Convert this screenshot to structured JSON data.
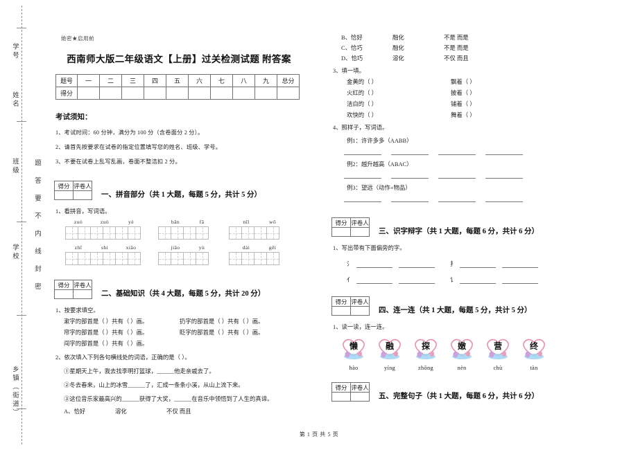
{
  "sidebar": {
    "col_right_text": "题  答  要  不  内  线  封  密",
    "fields": [
      "学号",
      "姓名",
      "班级",
      "学校",
      "乡镇（街道）"
    ]
  },
  "header": {
    "secret_mark": "绝密★启用前",
    "title": "西南师大版二年级语文【上册】过关检测试题 附答案"
  },
  "score_table": {
    "row1_label": "题号",
    "row2_label": "得分",
    "columns": [
      "一",
      "二",
      "三",
      "四",
      "五",
      "六",
      "七",
      "八",
      "九",
      "总分"
    ]
  },
  "notice": {
    "title": "考试须知：",
    "items": [
      "1、考试时间：60 分钟，满分为 100 分（含卷面分 2 分）。",
      "2、请首先按要求在试卷的指定位置填写您的姓名、班级、学号。",
      "3、不要在试卷上乱写乱画，卷面不整洁扣 2 分。"
    ]
  },
  "grader_box": {
    "score_label": "得分",
    "grader_label": "评卷人"
  },
  "sections": {
    "s1": {
      "title": "一、拼音部分（共 1 大题，每题 5 分，共计 5 分）",
      "q1": "1、看拼音，写词语。",
      "groups": [
        {
          "pinyin": [
            "zuò",
            "zuò",
            "yè"
          ],
          "cells": 6
        },
        {
          "pinyin": [
            "bān",
            "fā"
          ],
          "cells": 4
        },
        {
          "pinyin": [
            "nǐl",
            "wǒ"
          ],
          "cells": 4
        },
        {
          "pinyin": [
            "zhī",
            "shi",
            "xiǎo"
          ],
          "cells": 6
        },
        {
          "pinyin": [
            "jiāo",
            "yù"
          ],
          "cells": 4
        },
        {
          "pinyin": [
            "dài",
            "gěi"
          ],
          "cells": 4
        }
      ]
    },
    "s2": {
      "title": "二、基础知识（共 4 大题，每题 5 分，共计 20 分）",
      "q1": "1、按要求填空。",
      "q1_rows": [
        {
          "left": "漱字的部首是（      ）共有（      ）画。",
          "right": "扔字的部首是（      ）共有（      ）画。"
        },
        {
          "left": "帘字的部首是（      ）共有（      ）画。",
          "right": "眨字的部首是（      ）共有（      ）画。"
        },
        {
          "left": "闯字的部首是（      ）共有（      ）画。",
          "right": ""
        }
      ],
      "q2": "2、依次填入下列各句横线处的词语，正确的是（     ）。",
      "q2_items": [
        "①星期天上午，我去找李明打篮球，______他走亲戚去了。",
        "②冬去春来，山上的冰雪______了，汇成一条条小溪，从山上流下来。",
        "③这位音乐家最高兴的______获得了大奖，______在音乐中领悟到了人生的真谛。"
      ],
      "choices": [
        {
          "label": "A、",
          "o1": "恰好",
          "o2": "溶化",
          "o3": "不仅 而且"
        },
        {
          "label": "B、",
          "o1": "恰好",
          "o2": "融化",
          "o3": "不是 而是"
        },
        {
          "label": "C、",
          "o1": "恰巧",
          "o2": "融化",
          "o3": "不是 而是"
        },
        {
          "label": "D、",
          "o1": "恰巧",
          "o2": "溶化",
          "o3": "不仅 而且"
        }
      ],
      "q3": "3、填一填。",
      "q3_pairs": [
        {
          "left": "金黄的（            ）",
          "right": "飘着（            ）"
        },
        {
          "left": "火红的（            ）",
          "right": "披着（            ）"
        },
        {
          "left": "洁白的（            ）",
          "right": "铺着（            ）"
        },
        {
          "left": "欢快的（            ）",
          "right": "舞着（            ）"
        }
      ],
      "q4": "4、照样子，写词语。",
      "q4_examples": [
        "例1：许许多多（AABB）",
        "例2：越升越高（ABAC）",
        "例3：望远（动作+物品）"
      ]
    },
    "s3": {
      "title": "三、识字辩字（共 1 大题，每题 6 分，共计 6 分）",
      "q1": "1、写出带有下面偏旁的字。",
      "radicals": [
        {
          "a": "氵",
          "b": "扌"
        },
        {
          "a": "亻",
          "b": "讠"
        }
      ]
    },
    "s4": {
      "title": "四、连一连（共 1 大题，每题 5 分，共计 5 分）",
      "q1": "1、读一读，连一连。",
      "items": [
        {
          "char": "懒",
          "pinyin": "hào"
        },
        {
          "char": "融",
          "pinyin": "yíng"
        },
        {
          "char": "探",
          "pinyin": "zhōng"
        },
        {
          "char": "嫩",
          "pinyin": "nèn"
        },
        {
          "char": "营",
          "pinyin": "chù"
        },
        {
          "char": "终",
          "pinyin": "tàn"
        }
      ]
    },
    "s5": {
      "title": "五、完整句子（共 1 大题，每题 6 分，共计 6 分）"
    }
  },
  "footer": {
    "text": "第 1 页 共 5 页"
  }
}
